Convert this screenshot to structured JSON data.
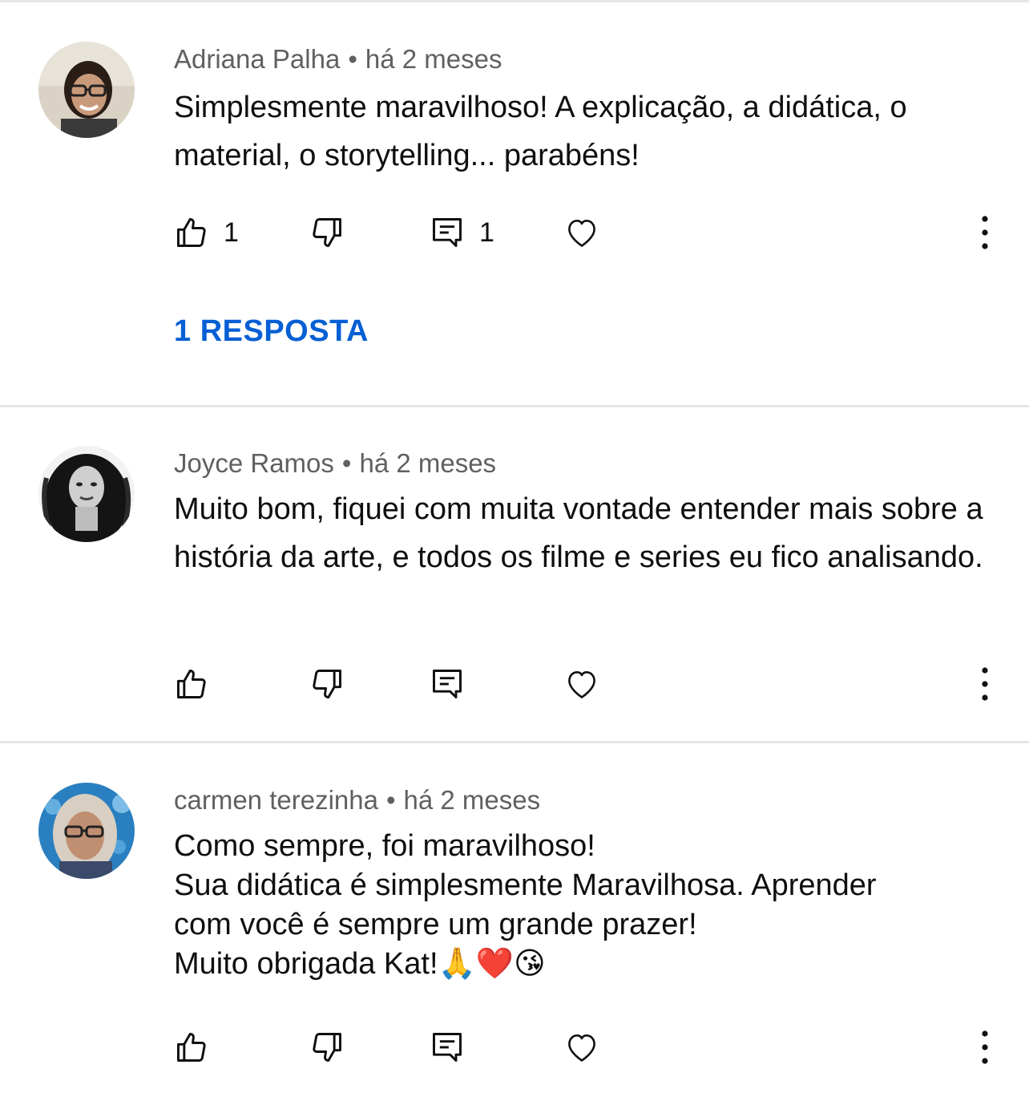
{
  "comments": [
    {
      "author": "Adriana Palha",
      "time": "há 2 meses",
      "separator": "•",
      "text": "Simplesmente maravilhoso! A explicação, a didática, o material, o storytelling... parabéns!",
      "likes": "1",
      "replies_count": "1",
      "replies_link": "1 RESPOSTA"
    },
    {
      "author": "Joyce Ramos",
      "time": "há 2 meses",
      "separator": "•",
      "text": "Muito bom, fiquei com muita vontade entender mais sobre a história da arte, e todos os filme e series eu fico analisando."
    },
    {
      "author": "carmen terezinha",
      "time": "há 2 meses",
      "separator": "•",
      "text_lines": [
        "Como sempre, foi maravilhoso!",
        "Sua didática é simplesmente Maravilhosa. Aprender",
        "com você é sempre um grande prazer!",
        "Muito obrigada Kat!🙏❤️😘"
      ]
    }
  ],
  "icons": {
    "like": "thumbs-up-icon",
    "dislike": "thumbs-down-icon",
    "reply": "reply-comment-icon",
    "heart": "heart-icon",
    "more": "more-vertical-icon"
  },
  "colors": {
    "link": "#065fd4",
    "meta": "#606060",
    "text": "#0f0f0f",
    "divider": "#e6e6e6"
  }
}
